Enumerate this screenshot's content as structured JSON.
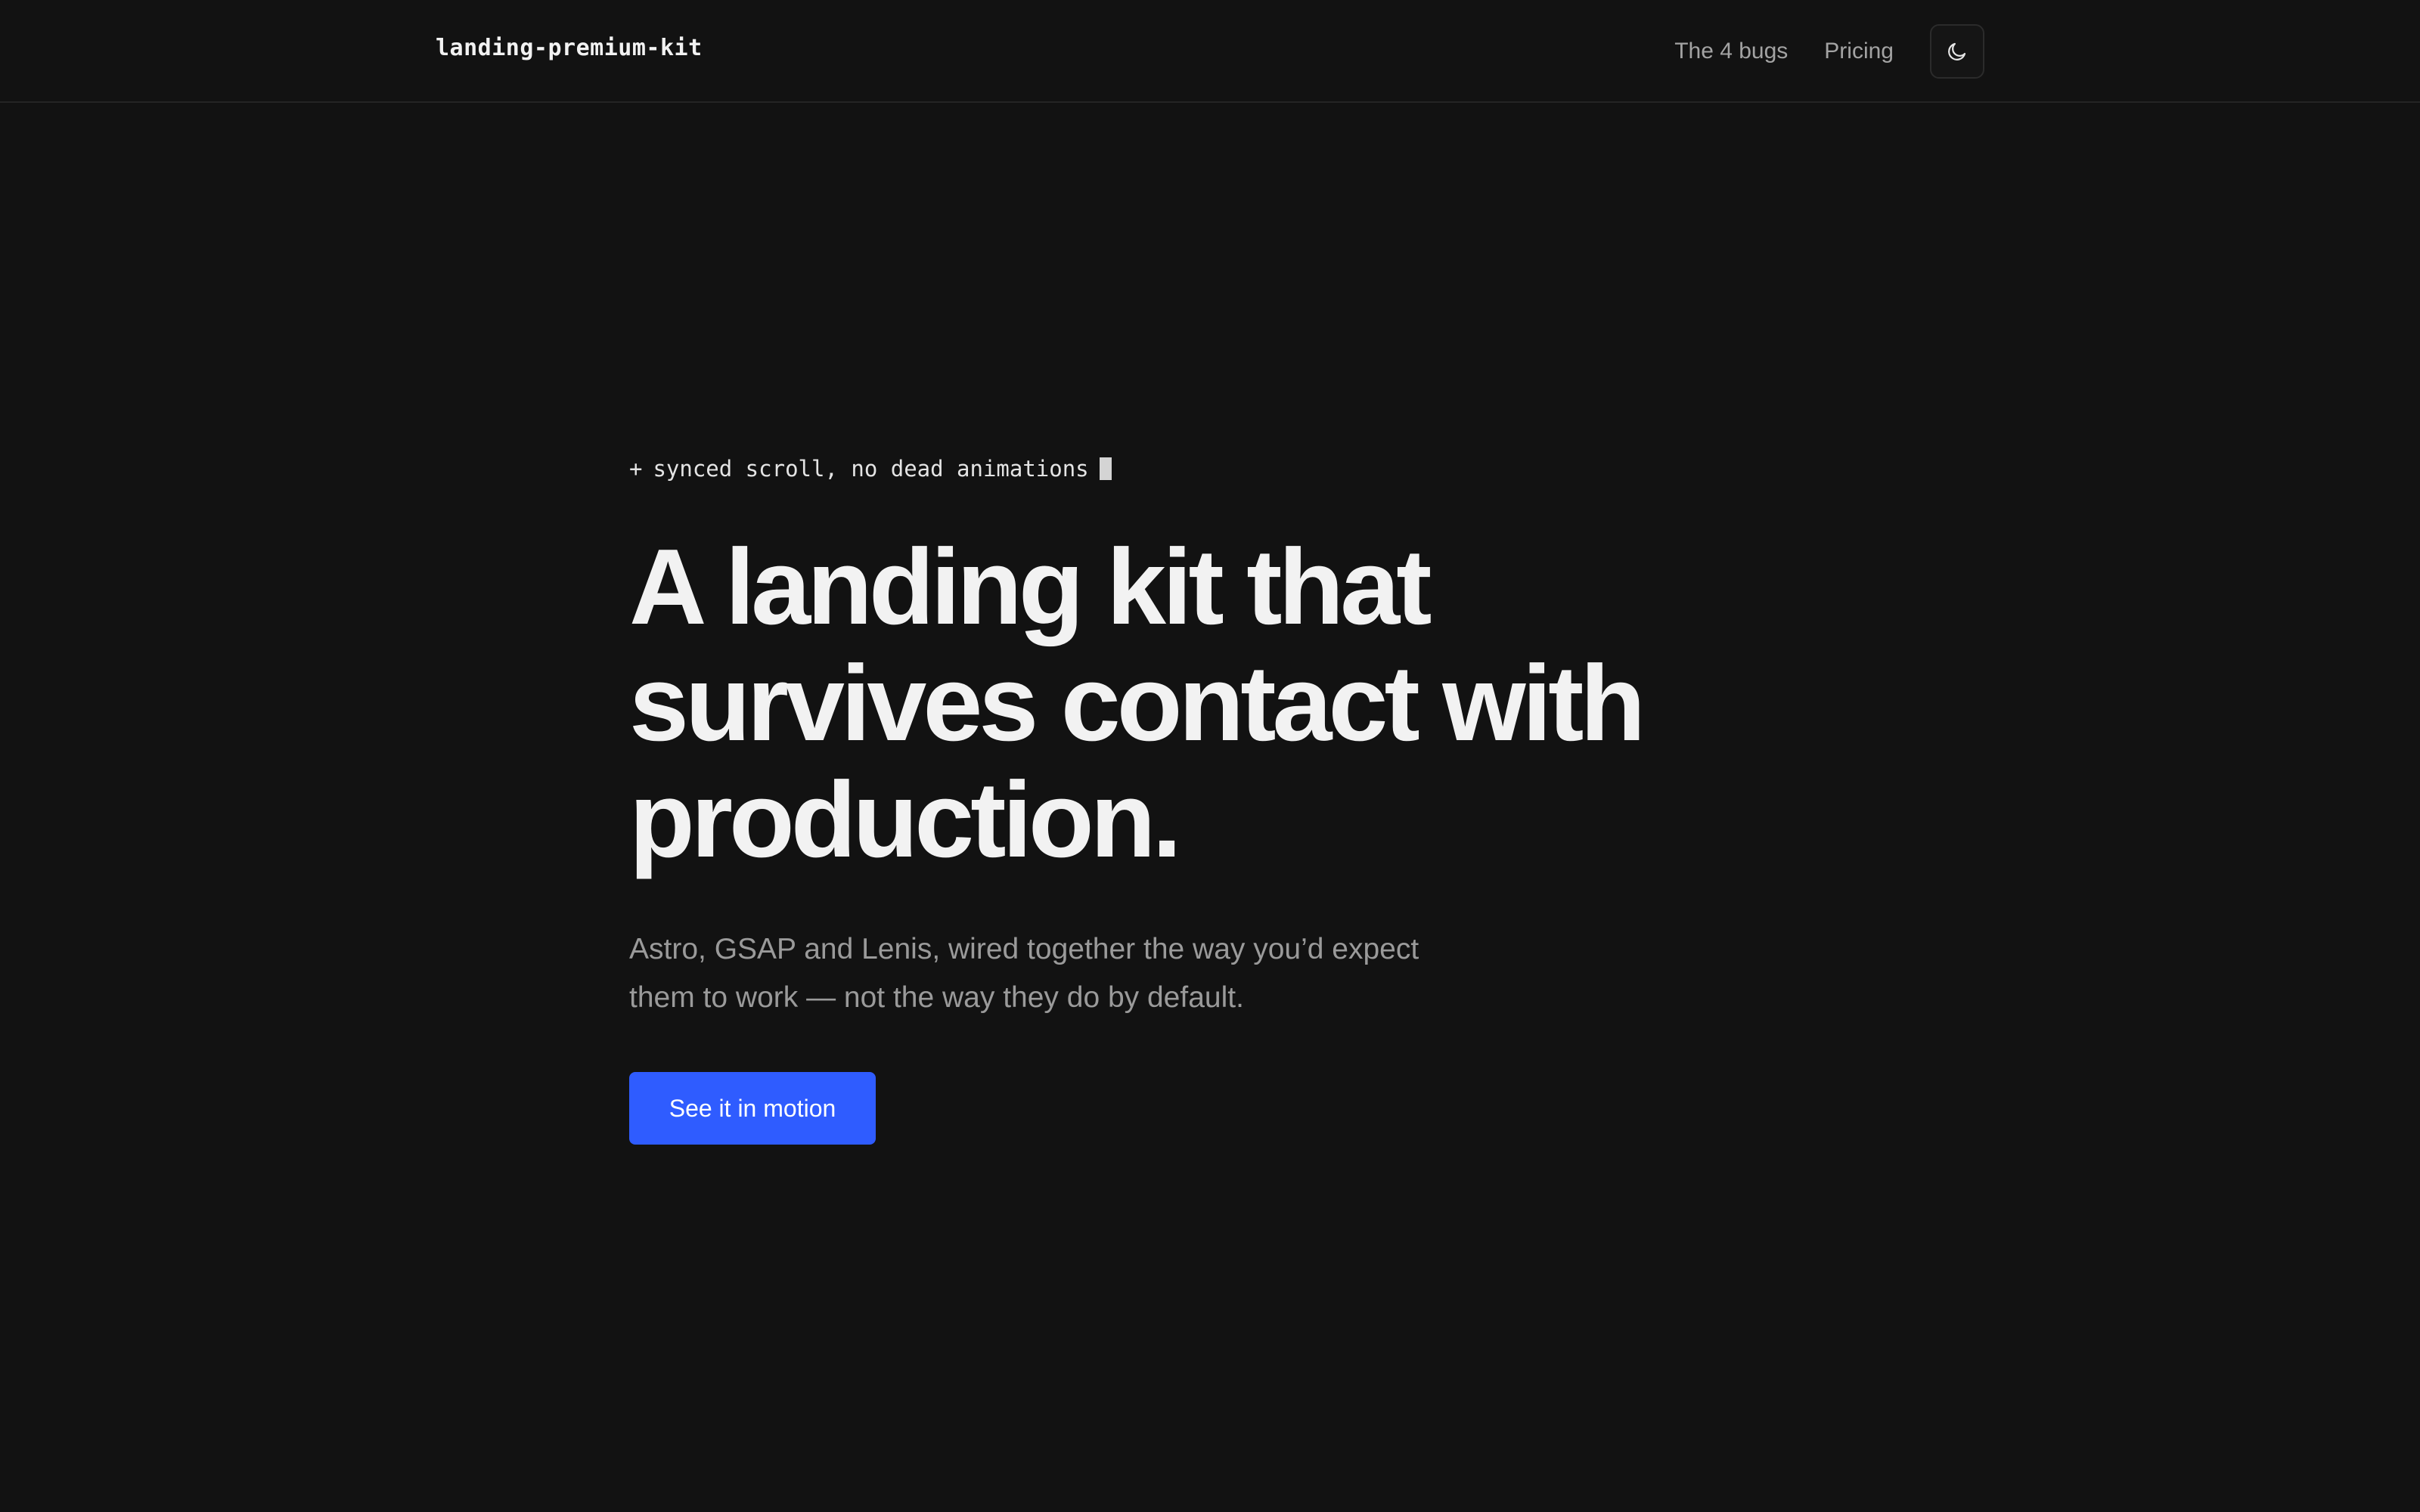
{
  "header": {
    "brand": "landing-premium-kit",
    "nav": [
      {
        "label": "The 4 bugs"
      },
      {
        "label": "Pricing"
      }
    ],
    "theme_toggle_icon": "moon-icon"
  },
  "hero": {
    "eyebrow_prefix": "+",
    "eyebrow": "synced scroll, no dead animations",
    "headline_lines": [
      "A landing kit that",
      "survives contact with",
      "production."
    ],
    "lede_lines": [
      "Astro, GSAP and Lenis, wired together the way you’d expect",
      "them to work — not the way they do by default."
    ],
    "cta_label": "See it in motion"
  },
  "colors": {
    "background": "#121212",
    "accent": "#2f5cff",
    "text": "#f2f2f2",
    "muted": "#9a9a9a"
  }
}
